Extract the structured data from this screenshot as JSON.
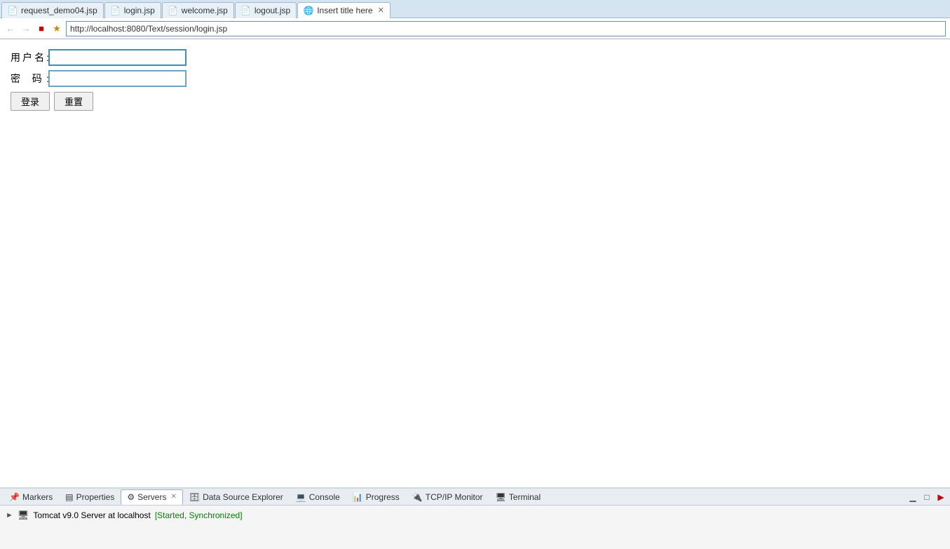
{
  "tabs": [
    {
      "id": "tab1",
      "label": "request_demo04.jsp",
      "icon": "file",
      "active": false,
      "closable": false
    },
    {
      "id": "tab2",
      "label": "login.jsp",
      "icon": "file",
      "active": false,
      "closable": false
    },
    {
      "id": "tab3",
      "label": "welcome.jsp",
      "icon": "file",
      "active": false,
      "closable": false
    },
    {
      "id": "tab4",
      "label": "logout.jsp",
      "icon": "file",
      "active": false,
      "closable": false
    },
    {
      "id": "tab5",
      "label": "Insert title here",
      "icon": "globe",
      "active": true,
      "closable": true
    }
  ],
  "address_bar": {
    "url": "http://localhost:8080/Text/session/login.jsp",
    "back_title": "Back",
    "forward_title": "Forward",
    "stop_title": "Stop",
    "bookmark_title": "Bookmark"
  },
  "form": {
    "username_label": "用户名:",
    "password_label": "密  码:",
    "login_button": "登录",
    "reset_button": "重置"
  },
  "bottom_panel": {
    "tabs": [
      {
        "id": "markers",
        "label": "Markers",
        "icon": "📌",
        "active": false,
        "closable": false
      },
      {
        "id": "properties",
        "label": "Properties",
        "icon": "📋",
        "active": false,
        "closable": false
      },
      {
        "id": "servers",
        "label": "Servers",
        "icon": "🖥",
        "active": true,
        "closable": true
      },
      {
        "id": "datasource",
        "label": "Data Source Explorer",
        "icon": "🗄",
        "active": false,
        "closable": false
      },
      {
        "id": "console",
        "label": "Console",
        "icon": "💻",
        "active": false,
        "closable": false
      },
      {
        "id": "progress",
        "label": "Progress",
        "icon": "📊",
        "active": false,
        "closable": false
      },
      {
        "id": "tcpip",
        "label": "TCP/IP Monitor",
        "icon": "🔌",
        "active": false,
        "closable": false
      },
      {
        "id": "terminal",
        "label": "Terminal",
        "icon": "🖥",
        "active": false,
        "closable": false
      }
    ],
    "action_buttons": [
      "minimize",
      "maximize",
      "run"
    ],
    "server": {
      "name": "Tomcat v9.0 Server at localhost",
      "status": "[Started, Synchronized]"
    }
  }
}
